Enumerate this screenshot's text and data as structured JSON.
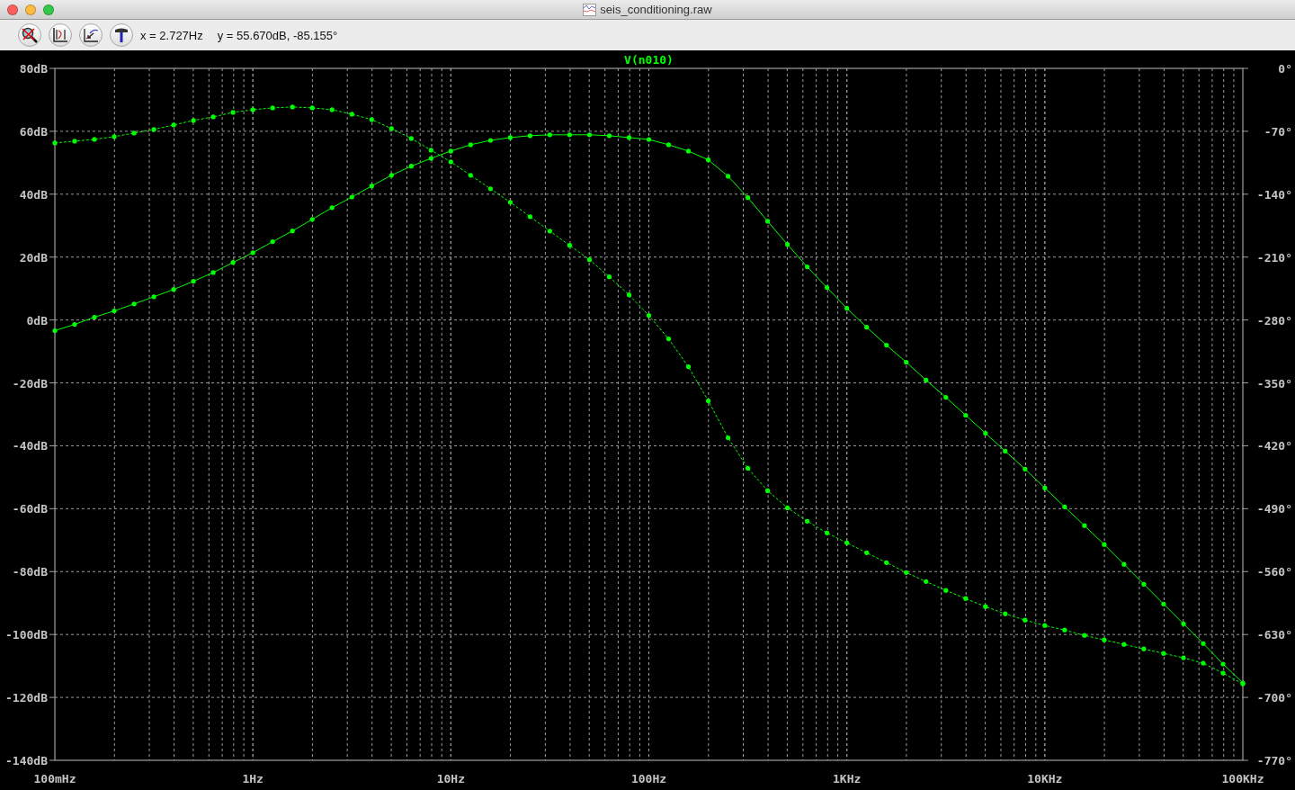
{
  "window": {
    "title": "seis_conditioning.raw"
  },
  "toolbar": {
    "cursor_x": "x = 2.727Hz",
    "cursor_y": "y = 55.670dB, -85.155°"
  },
  "plot": {
    "chart_data": {
      "type": "line",
      "title": "V(n010)",
      "categories": [
        "100mHz",
        null,
        null,
        null,
        null,
        null,
        null,
        null,
        null,
        null,
        "1Hz",
        null,
        null,
        null,
        null,
        null,
        null,
        null,
        null,
        null,
        "10Hz",
        null,
        null,
        null,
        null,
        null,
        null,
        null,
        null,
        null,
        "100Hz",
        null,
        null,
        null,
        null,
        null,
        null,
        null,
        null,
        null,
        "1KHz",
        null,
        null,
        null,
        null,
        null,
        null,
        null,
        null,
        null,
        "10KHz",
        null,
        null,
        null,
        null,
        null,
        null,
        null,
        null,
        null,
        "100KHz"
      ],
      "series": [
        {
          "color": "#00ff00",
          "values": [
            -3.4,
            -1.4,
            0.9,
            2.9,
            5.1,
            7.4,
            9.7,
            12.3,
            15.1,
            18.3,
            21.4,
            24.9,
            28.3,
            32,
            35.7,
            39.1,
            42.6,
            46,
            48.9,
            51.4,
            53.7,
            55.7,
            57.1,
            58,
            58.6,
            58.9,
            58.9,
            58.9,
            58.6,
            58,
            57.4,
            55.7,
            53.7,
            50.9,
            45.7,
            38.9,
            31.4,
            24,
            16.9,
            10.3,
            3.7,
            -2.3,
            -8,
            -13.4,
            -19.1,
            -24.6,
            -30.3,
            -36,
            -41.7,
            -47.4,
            -53.4,
            -59.4,
            -65.4,
            -71.4,
            -77.7,
            -84,
            -90.3,
            -96.6,
            -102.9,
            -109.4,
            -115.4
          ]
        },
        {
          "color": "#00ff00",
          "axis": "y2",
          "line_style": "dashed",
          "values": [
            -83,
            -81,
            -79,
            -76,
            -72,
            -68,
            -63,
            -58,
            -54,
            -49,
            -46,
            -44,
            -43,
            -44,
            -46,
            -51,
            -57,
            -67,
            -78,
            -91,
            -104,
            -119,
            -134,
            -149,
            -165,
            -181,
            -197,
            -213,
            -232,
            -252,
            -275,
            -301,
            -332,
            -370,
            -411,
            -445,
            -470,
            -489,
            -504,
            -517,
            -528,
            -539,
            -550,
            -561,
            -571,
            -581,
            -590,
            -599,
            -607,
            -614,
            -620,
            -625,
            -631,
            -636,
            -641,
            -646,
            -651,
            -656,
            -662,
            -673,
            -685
          ]
        }
      ],
      "grid": true,
      "ylim": [
        -140,
        80
      ],
      "y2lim": [
        -770,
        0
      ],
      "yticks": [
        {
          "value": 80,
          "label": "80dB"
        },
        {
          "value": 60,
          "label": "60dB"
        },
        {
          "value": 40,
          "label": "40dB"
        },
        {
          "value": 20,
          "label": "20dB"
        },
        {
          "value": 0,
          "label": "0dB"
        },
        {
          "value": -20,
          "label": "-20dB"
        },
        {
          "value": -40,
          "label": "-40dB"
        },
        {
          "value": -60,
          "label": "-60dB"
        },
        {
          "value": -80,
          "label": "-80dB"
        },
        {
          "value": -100,
          "label": "-100dB"
        },
        {
          "value": -120,
          "label": "-120dB"
        },
        {
          "value": -140,
          "label": "-140dB"
        }
      ],
      "y2ticks": [
        {
          "value": 0,
          "label": "0°"
        },
        {
          "value": -70,
          "label": "-70°"
        },
        {
          "value": -140,
          "label": "-140°"
        },
        {
          "value": -210,
          "label": "-210°"
        },
        {
          "value": -280,
          "label": "-280°"
        },
        {
          "value": -350,
          "label": "-350°"
        },
        {
          "value": -420,
          "label": "-420°"
        },
        {
          "value": -490,
          "label": "-490°"
        },
        {
          "value": -560,
          "label": "-560°"
        },
        {
          "value": -630,
          "label": "-630°"
        },
        {
          "value": -700,
          "label": "-700°"
        },
        {
          "value": -770,
          "label": "-770°"
        }
      ]
    }
  }
}
